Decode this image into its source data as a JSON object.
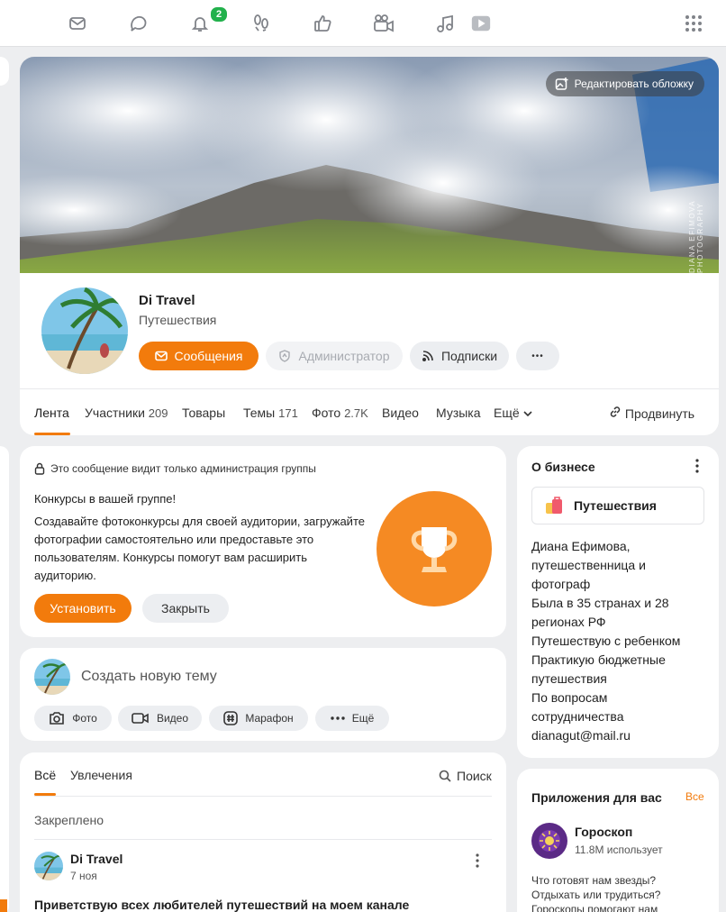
{
  "topbar": {
    "icons": [
      "mail-icon",
      "chat-icon",
      "bell-icon",
      "footprints-icon",
      "like-icon",
      "video-camera-icon",
      "music-icon",
      "play-icon",
      "apps-grid-icon"
    ],
    "notifications_count": "2"
  },
  "cover": {
    "edit_label": "Редактировать обложку",
    "watermark": "DIANA EFIMOVA PHOTOGRAPHY"
  },
  "group": {
    "name": "Di Travel",
    "category": "Путешествия",
    "messages_button": "Сообщения",
    "admin_button": "Администратор",
    "subscriptions_button": "Подписки",
    "more_button": "•••"
  },
  "tabs": {
    "feed": "Лента",
    "members": "Участники",
    "members_count": "209",
    "goods": "Товары",
    "topics": "Темы",
    "topics_count": "171",
    "photos": "Фото",
    "photos_count": "2.7K",
    "video": "Видео",
    "music": "Музыка",
    "more": "Ещё",
    "promote": "Продвинуть"
  },
  "promo": {
    "notice": "Это сообщение видит только администрация группы",
    "title": "Конкурсы в вашей группе!",
    "body": "Создавайте фотоконкурсы для своей аудитории, загружайте фотографии самостоятельно или предоставьте это пользователям. Конкурсы помогут вам расширить аудиторию.",
    "install_button": "Установить",
    "close_button": "Закрыть"
  },
  "composer": {
    "placeholder": "Создать новую тему",
    "photo": "Фото",
    "video": "Видео",
    "marathon": "Марафон",
    "more": "Ещё"
  },
  "feed": {
    "tab_all": "Всё",
    "tab_hobbies": "Увлечения",
    "search": "Поиск",
    "pinned": "Закреплено",
    "post_author": "Di Travel",
    "post_date": "7 ноя",
    "post_title": "Приветствую всех любителей путешествий на моем канале"
  },
  "about": {
    "title": "О бизнесе",
    "category": "Путешествия",
    "lines": [
      "Диана Ефимова,",
      "путешественница и",
      "фотограф",
      "Была в 35 странах и 28",
      "регионах РФ",
      "Путешествую с ребенком",
      "Практикую бюджетные",
      "путешествия",
      "По вопросам",
      "сотрудничества",
      "dianagut@mail.ru"
    ]
  },
  "apps": {
    "title": "Приложения для вас",
    "all": "Все",
    "app_name": "Гороскоп",
    "app_users": "11.8M использует",
    "app_desc_1": "Что готовят нам звезды?",
    "app_desc_2": "Отдыхать или трудиться?",
    "app_desc_3": "Гороскопы помогают нам"
  },
  "colors": {
    "accent": "#f27b0c",
    "badge": "#22b14c",
    "background": "#edeef0"
  }
}
